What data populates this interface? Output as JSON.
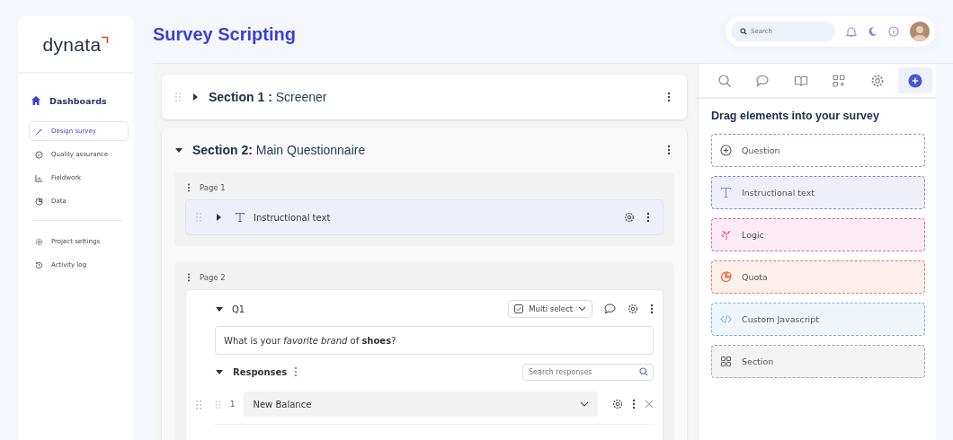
{
  "logo": {
    "text": "dynata"
  },
  "sidebar": {
    "header": {
      "label": "Dashboards",
      "kind": "home"
    },
    "items": [
      {
        "label": "Design survey",
        "kind": "pen",
        "selected": true
      },
      {
        "label": "Quality assurance",
        "kind": "check",
        "selected": false
      },
      {
        "label": "Fieldwork",
        "kind": "chart",
        "selected": false
      },
      {
        "label": "Data",
        "kind": "pie",
        "selected": false
      }
    ],
    "footer_items": [
      {
        "label": "Project settings",
        "kind": "gear",
        "selected": false
      },
      {
        "label": "Activity log",
        "kind": "history",
        "selected": false
      }
    ]
  },
  "page_title": "Survey Scripting",
  "topbar": {
    "search": {
      "placeholder": "Search"
    }
  },
  "sections": [
    {
      "title_bold": "Section 1 :",
      "title": "Screener",
      "expanded": false
    },
    {
      "title_bold": "Section 2:",
      "title": "Main Questionnaire",
      "expanded": true,
      "pages": [
        {
          "label": "Page 1",
          "elements": [
            {
              "kind": "instructional",
              "label": "Instructional text",
              "expanded": false
            }
          ]
        },
        {
          "label": "Page 2",
          "elements": [
            {
              "kind": "question",
              "id": "Q1",
              "expanded": true,
              "type": "Multi select",
              "text": "What is your *favorite brand* of **shoes**?",
              "responses_label": "Responses",
              "responses_expanded": true,
              "search_placeholder": "Search responses",
              "responses": [
                {
                  "number": "1",
                  "value": "New Balance"
                }
              ]
            }
          ]
        }
      ]
    }
  ],
  "panel": {
    "tabs": [
      {
        "kind": "search",
        "selected": false
      },
      {
        "kind": "comment",
        "selected": false
      },
      {
        "kind": "book",
        "selected": false
      },
      {
        "kind": "grid-plus",
        "selected": false
      },
      {
        "kind": "gear",
        "selected": false
      },
      {
        "kind": "plus",
        "selected": true
      }
    ],
    "heading": "Drag elements into your survey",
    "elements": [
      {
        "kind": "question",
        "label": "Question",
        "color": "#8a8fd6"
      },
      {
        "kind": "text",
        "label": "Instructional text",
        "color": "#7f86d9"
      },
      {
        "kind": "logic",
        "label": "Logic",
        "color": "#d66aa8"
      },
      {
        "kind": "quota",
        "label": "Quota",
        "color": "#e8775c"
      },
      {
        "kind": "code",
        "label": "Custom Javascript",
        "color": "#6fb3e8"
      },
      {
        "kind": "section",
        "label": "Section",
        "color": "#a8a8a8"
      }
    ]
  }
}
